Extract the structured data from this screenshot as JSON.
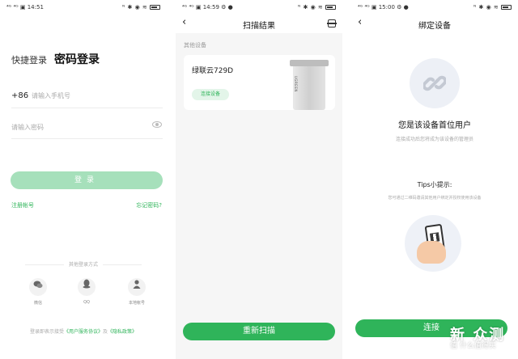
{
  "screen1": {
    "status": {
      "left": "⁴ᴳ ⁴ᴳ ▣ 14:51",
      "right": "ᴺ ✱ ◉ ≋"
    },
    "tab_quick": "快捷登录",
    "tab_password": "密码登录",
    "country_code": "+86",
    "phone_placeholder": "请输入手机号",
    "password_placeholder": "请输入密码",
    "login_label": "登录",
    "register_label": "注册帐号",
    "forgot_label": "忘记密码?",
    "other_login_title": "其他登录方式",
    "social": [
      {
        "label": "微信",
        "icon": "wechat-icon"
      },
      {
        "label": "QQ",
        "icon": "qq-icon"
      },
      {
        "label": "本地帐号",
        "icon": "user-icon"
      }
    ],
    "agreement_prefix": "登录即表示接受",
    "agreement_terms": "《用户服务协议》",
    "agreement_and": "及",
    "agreement_privacy": "《隐私政策》"
  },
  "screen2": {
    "status": {
      "left": "⁴ᴳ ⁴ᴳ ▣ 14:59 ⚙ ●",
      "right": "ᴺ ✱ ◉ ≋"
    },
    "title": "扫描结果",
    "section_label": "其他设备",
    "device_name": "绿联云729D",
    "connect_label": "连接设备",
    "device_logo": "UGREEN",
    "rescan_label": "重新扫描"
  },
  "screen3": {
    "status": {
      "left": "⁴ᴳ ⁴ᴳ ▣ 15:00 ⚙ ●",
      "right": "ᴺ ✱ ◉ ≋"
    },
    "title": "绑定设备",
    "first_user": "您是该设备首位用户",
    "first_user_sub": "连接成功后您将成为该设备的管理员",
    "tips_title": "Tips小提示:",
    "tips_sub": "您可通过二维码邀请其他用户绑定并授权使用该设备",
    "connect_label": "连接"
  },
  "watermark": {
    "main": "新 众测",
    "sub": "值 什么值得买"
  },
  "colors": {
    "accent": "#2fb45a",
    "accent_light": "#a6e0bb"
  }
}
